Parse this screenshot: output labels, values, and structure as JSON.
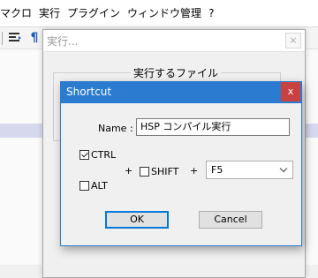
{
  "menubar": {
    "items": [
      "マクロ",
      "実行",
      "プラグイン",
      "ウィンドウ管理",
      "?"
    ]
  },
  "toolbar": {
    "icons": [
      "list-wrap-icon",
      "paragraph-icon"
    ]
  },
  "background_dialog": {
    "title": "実行...",
    "close_label": "×",
    "group_label": "実行するファイル"
  },
  "shortcut_dialog": {
    "title": "Shortcut",
    "close_label": "x",
    "name_label": "Name :",
    "name_value": "HSP コンパイル実行",
    "ctrl_label": "CTRL",
    "ctrl_checked": true,
    "alt_label": "ALT",
    "alt_checked": false,
    "shift_label": "SHIFT",
    "shift_checked": false,
    "plus_1": "+",
    "plus_2": "+",
    "key_selected": "F5",
    "ok_label": "OK",
    "cancel_label": "Cancel"
  },
  "colors": {
    "title_bar": "#2b7bd0",
    "close_button": "#c84242",
    "editor_highlight": "#d6d8ee"
  }
}
